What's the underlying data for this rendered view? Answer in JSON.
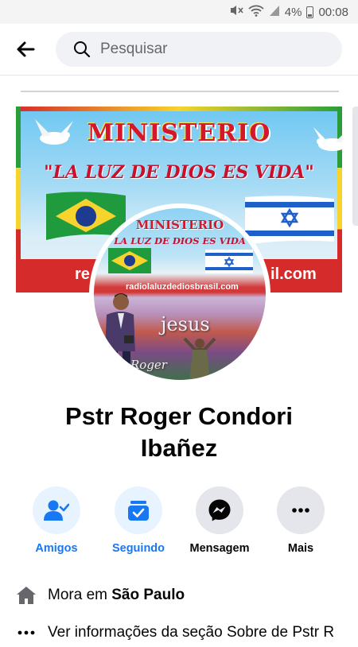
{
  "status_bar": {
    "battery": "4%",
    "time": "00:08"
  },
  "top_bar": {
    "search_placeholder": "Pesquisar"
  },
  "cover": {
    "title": "MINISTERIO",
    "subtitle": "\"LA LUZ DE DIOS ES VIDA\"",
    "url_fragment": "re",
    "url_end": "il.com"
  },
  "avatar": {
    "title": "MINISTERIO",
    "subtitle": "\"LA LUZ DE DIOS ES VIDA\"",
    "url": "radiolaluzdediosbrasil.com",
    "caption": "jesus",
    "signature": "Roger"
  },
  "profile": {
    "name_line1": "Pstr Roger Condori",
    "name_line2": "Ibañez"
  },
  "actions": [
    {
      "label": "Amigos",
      "icon": "friends-check-icon",
      "color": "#1877f2"
    },
    {
      "label": "Seguindo",
      "icon": "following-inbox-icon",
      "color": "#1877f2"
    },
    {
      "label": "Mensagem",
      "icon": "messenger-icon",
      "color": "#050505"
    },
    {
      "label": "Mais",
      "icon": "more-dots-icon",
      "color": "#050505"
    }
  ],
  "info": {
    "lives_prefix": "Mora em ",
    "lives_city": "São Paulo",
    "about_text": "Ver informações da seção Sobre de Pstr R"
  }
}
